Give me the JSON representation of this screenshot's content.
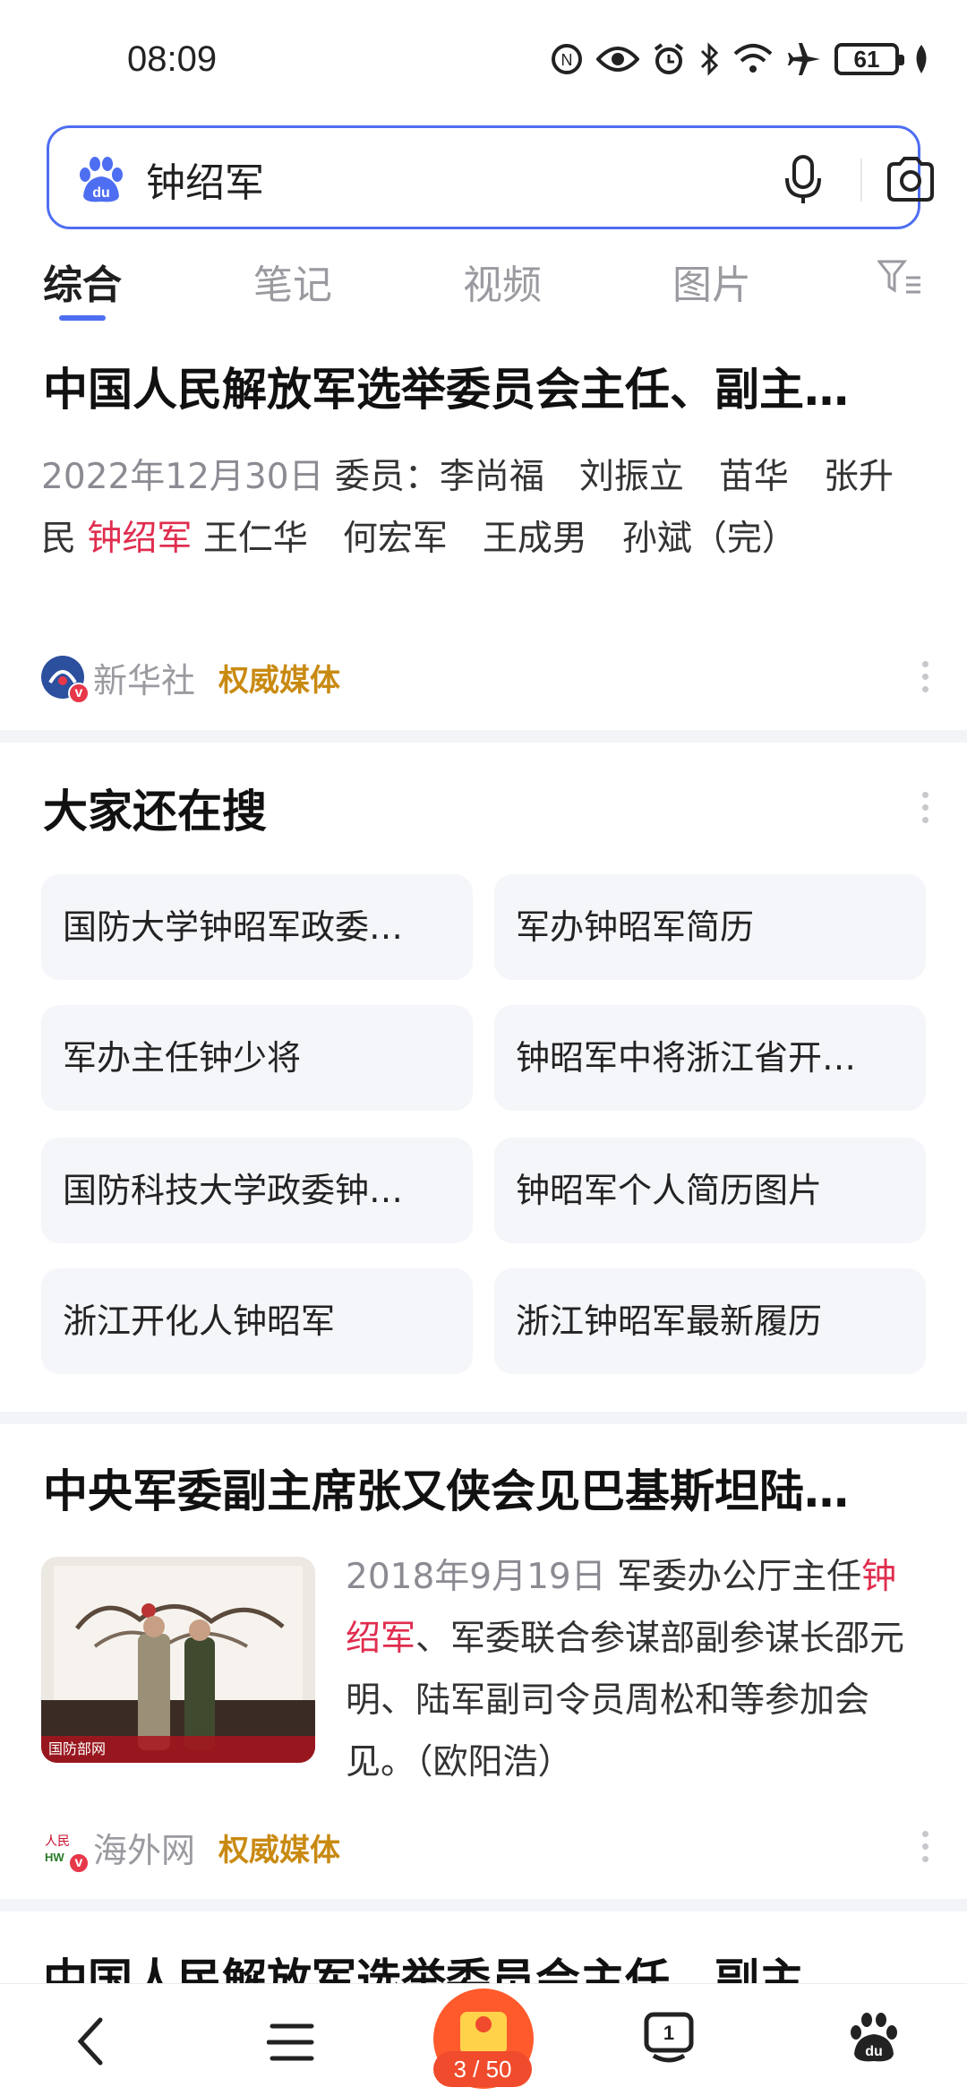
{
  "status_bar": {
    "time": "08:09",
    "battery": "61",
    "icons": [
      "network-icon",
      "eye-icon",
      "alarm-icon",
      "bluetooth-icon",
      "wifi-icon",
      "airplane-icon",
      "battery-icon",
      "leaf-icon"
    ]
  },
  "search": {
    "query": "钟绍军",
    "logo": "baidu-paw-icon",
    "voice_icon": "microphone-icon",
    "camera_icon": "camera-icon"
  },
  "tabs": [
    {
      "label": "综合",
      "active": true
    },
    {
      "label": "笔记",
      "active": false
    },
    {
      "label": "视频",
      "active": false
    },
    {
      "label": "图片",
      "active": false
    }
  ],
  "result1": {
    "title": "中国人民解放军选举委员会主任、副主…",
    "date": "2022年12月30日",
    "text_a": "委员：李尚福　刘振立　苗华　张升民",
    "highlight": "钟绍军",
    "text_b": "王仁华　何宏军　王成男　孙斌（完）",
    "source": "新华社",
    "badge": "权威媒体"
  },
  "related": {
    "title": "大家还在搜",
    "items": [
      "国防大学钟昭军政委…",
      "军办钟昭军简历",
      "军办主任钟少将",
      "钟昭军中将浙江省开…",
      "国防科技大学政委钟…",
      "钟昭军个人简历图片",
      "浙江开化人钟昭军",
      "浙江钟昭军最新履历"
    ]
  },
  "result2": {
    "title": "中央军委副主席张又侠会见巴基斯坦陆…",
    "date": "2018年9月19日",
    "text_a": "军委办公厅主任",
    "highlight": "钟绍军",
    "text_b": "、军委联合参谋部副参谋长邵元明、陆军副司令员周松和等参加会见。（欧阳浩）",
    "source": "海外网",
    "badge": "权威媒体",
    "thumb_watermark": "国防部网"
  },
  "result3": {
    "title": "中国人民解放军选举委员会主任、副主…"
  },
  "bottom_nav": {
    "page_counter": "3 / 50",
    "notification_count": "1",
    "icons": [
      "back-icon",
      "menu-icon",
      "red-packet-icon",
      "tabs-icon",
      "baidu-home-icon"
    ]
  },
  "colors": {
    "accent": "#4e6ef2",
    "highlight": "#e02d4e",
    "authority": "#c98a12"
  }
}
